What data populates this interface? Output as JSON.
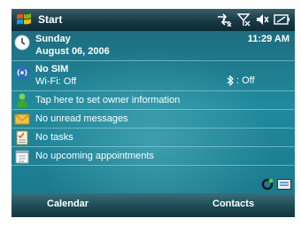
{
  "titlebar": {
    "title": "Start",
    "status_icons": [
      "connectivity-icon",
      "signal-off-icon",
      "volume-muted-icon",
      "battery-icon"
    ]
  },
  "today": {
    "date": {
      "day": "Sunday",
      "date": "August 06, 2006",
      "time": "11:29 AM",
      "icon": "clock-icon"
    },
    "network": {
      "sim": "No SIM",
      "wifi": "Wi-Fi: Off",
      "bluetooth": ": Off",
      "icon": "wireless-icon",
      "bt_icon": "bluetooth-icon"
    },
    "items": [
      {
        "label": "Tap here to set owner information",
        "icon": "owner-icon"
      },
      {
        "label": "No unread messages",
        "icon": "envelope-icon"
      },
      {
        "label": "No tasks",
        "icon": "tasks-icon"
      },
      {
        "label": "No upcoming appointments",
        "icon": "calendar-icon"
      }
    ],
    "tray_icons": [
      "sync-icon",
      "input-panel-icon"
    ]
  },
  "softkeys": {
    "left": "Calendar",
    "right": "Contacts"
  },
  "colors": {
    "accent": "#218a9d",
    "titlebar": "#173a45"
  }
}
